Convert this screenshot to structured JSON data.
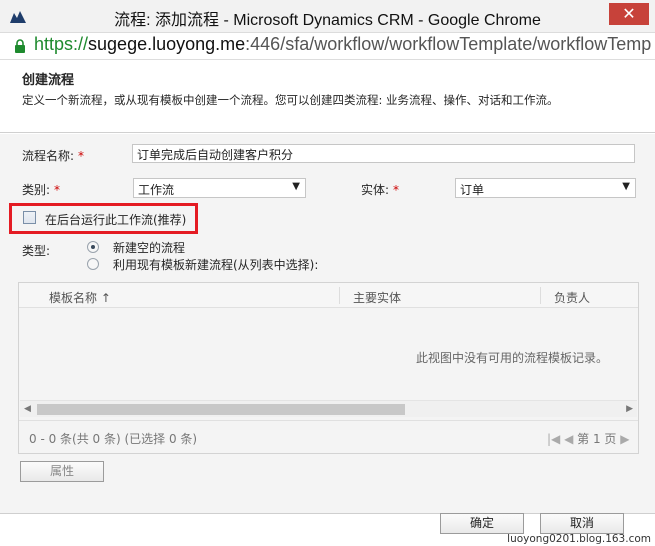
{
  "window": {
    "title": "流程: 添加流程 - Microsoft Dynamics CRM - Google Chrome",
    "close_label": "✕"
  },
  "address": {
    "scheme": "https://",
    "host": "sugege.luoyong.me",
    "path": ":446/sfa/workflow/workflowTemplate/workflowTemp"
  },
  "dialog": {
    "title": "创建流程",
    "description": "定义一个新流程，或从现有模板中创建一个流程。您可以创建四类流程: 业务流程、操作、对话和工作流。"
  },
  "form": {
    "name_label": "流程名称:",
    "name_value": "订单完成后自动创建客户积分",
    "category_label": "类别:",
    "category_value": "工作流",
    "entity_label": "实体:",
    "entity_value": "订单",
    "required_mark": "*",
    "background_label": "在后台运行此工作流(推荐)",
    "type_label": "类型:",
    "type_options": [
      "新建空的流程",
      "利用现有模板新建流程(从列表中选择):"
    ]
  },
  "grid": {
    "columns": [
      "模板名称 ↑",
      "主要实体",
      "负责人"
    ],
    "empty_message": "此视图中没有可用的流程模板记录。",
    "status": "0 - 0  条(共 0 条) (已选择 0 条)",
    "page_label": "第 1 页"
  },
  "buttons": {
    "properties": "属性",
    "ok": "确定",
    "cancel": "取消"
  },
  "watermark": "luoyong0201.blog.163.com"
}
